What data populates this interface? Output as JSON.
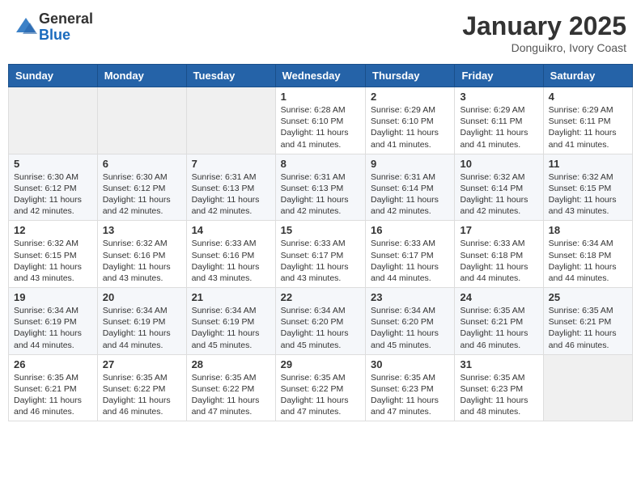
{
  "header": {
    "logo_general": "General",
    "logo_blue": "Blue",
    "month_title": "January 2025",
    "subtitle": "Donguikro, Ivory Coast"
  },
  "weekdays": [
    "Sunday",
    "Monday",
    "Tuesday",
    "Wednesday",
    "Thursday",
    "Friday",
    "Saturday"
  ],
  "weeks": [
    [
      {
        "day": "",
        "info": ""
      },
      {
        "day": "",
        "info": ""
      },
      {
        "day": "",
        "info": ""
      },
      {
        "day": "1",
        "info": "Sunrise: 6:28 AM\nSunset: 6:10 PM\nDaylight: 11 hours\nand 41 minutes."
      },
      {
        "day": "2",
        "info": "Sunrise: 6:29 AM\nSunset: 6:10 PM\nDaylight: 11 hours\nand 41 minutes."
      },
      {
        "day": "3",
        "info": "Sunrise: 6:29 AM\nSunset: 6:11 PM\nDaylight: 11 hours\nand 41 minutes."
      },
      {
        "day": "4",
        "info": "Sunrise: 6:29 AM\nSunset: 6:11 PM\nDaylight: 11 hours\nand 41 minutes."
      }
    ],
    [
      {
        "day": "5",
        "info": "Sunrise: 6:30 AM\nSunset: 6:12 PM\nDaylight: 11 hours\nand 42 minutes."
      },
      {
        "day": "6",
        "info": "Sunrise: 6:30 AM\nSunset: 6:12 PM\nDaylight: 11 hours\nand 42 minutes."
      },
      {
        "day": "7",
        "info": "Sunrise: 6:31 AM\nSunset: 6:13 PM\nDaylight: 11 hours\nand 42 minutes."
      },
      {
        "day": "8",
        "info": "Sunrise: 6:31 AM\nSunset: 6:13 PM\nDaylight: 11 hours\nand 42 minutes."
      },
      {
        "day": "9",
        "info": "Sunrise: 6:31 AM\nSunset: 6:14 PM\nDaylight: 11 hours\nand 42 minutes."
      },
      {
        "day": "10",
        "info": "Sunrise: 6:32 AM\nSunset: 6:14 PM\nDaylight: 11 hours\nand 42 minutes."
      },
      {
        "day": "11",
        "info": "Sunrise: 6:32 AM\nSunset: 6:15 PM\nDaylight: 11 hours\nand 43 minutes."
      }
    ],
    [
      {
        "day": "12",
        "info": "Sunrise: 6:32 AM\nSunset: 6:15 PM\nDaylight: 11 hours\nand 43 minutes."
      },
      {
        "day": "13",
        "info": "Sunrise: 6:32 AM\nSunset: 6:16 PM\nDaylight: 11 hours\nand 43 minutes."
      },
      {
        "day": "14",
        "info": "Sunrise: 6:33 AM\nSunset: 6:16 PM\nDaylight: 11 hours\nand 43 minutes."
      },
      {
        "day": "15",
        "info": "Sunrise: 6:33 AM\nSunset: 6:17 PM\nDaylight: 11 hours\nand 43 minutes."
      },
      {
        "day": "16",
        "info": "Sunrise: 6:33 AM\nSunset: 6:17 PM\nDaylight: 11 hours\nand 44 minutes."
      },
      {
        "day": "17",
        "info": "Sunrise: 6:33 AM\nSunset: 6:18 PM\nDaylight: 11 hours\nand 44 minutes."
      },
      {
        "day": "18",
        "info": "Sunrise: 6:34 AM\nSunset: 6:18 PM\nDaylight: 11 hours\nand 44 minutes."
      }
    ],
    [
      {
        "day": "19",
        "info": "Sunrise: 6:34 AM\nSunset: 6:19 PM\nDaylight: 11 hours\nand 44 minutes."
      },
      {
        "day": "20",
        "info": "Sunrise: 6:34 AM\nSunset: 6:19 PM\nDaylight: 11 hours\nand 44 minutes."
      },
      {
        "day": "21",
        "info": "Sunrise: 6:34 AM\nSunset: 6:19 PM\nDaylight: 11 hours\nand 45 minutes."
      },
      {
        "day": "22",
        "info": "Sunrise: 6:34 AM\nSunset: 6:20 PM\nDaylight: 11 hours\nand 45 minutes."
      },
      {
        "day": "23",
        "info": "Sunrise: 6:34 AM\nSunset: 6:20 PM\nDaylight: 11 hours\nand 45 minutes."
      },
      {
        "day": "24",
        "info": "Sunrise: 6:35 AM\nSunset: 6:21 PM\nDaylight: 11 hours\nand 46 minutes."
      },
      {
        "day": "25",
        "info": "Sunrise: 6:35 AM\nSunset: 6:21 PM\nDaylight: 11 hours\nand 46 minutes."
      }
    ],
    [
      {
        "day": "26",
        "info": "Sunrise: 6:35 AM\nSunset: 6:21 PM\nDaylight: 11 hours\nand 46 minutes."
      },
      {
        "day": "27",
        "info": "Sunrise: 6:35 AM\nSunset: 6:22 PM\nDaylight: 11 hours\nand 46 minutes."
      },
      {
        "day": "28",
        "info": "Sunrise: 6:35 AM\nSunset: 6:22 PM\nDaylight: 11 hours\nand 47 minutes."
      },
      {
        "day": "29",
        "info": "Sunrise: 6:35 AM\nSunset: 6:22 PM\nDaylight: 11 hours\nand 47 minutes."
      },
      {
        "day": "30",
        "info": "Sunrise: 6:35 AM\nSunset: 6:23 PM\nDaylight: 11 hours\nand 47 minutes."
      },
      {
        "day": "31",
        "info": "Sunrise: 6:35 AM\nSunset: 6:23 PM\nDaylight: 11 hours\nand 48 minutes."
      },
      {
        "day": "",
        "info": ""
      }
    ]
  ]
}
